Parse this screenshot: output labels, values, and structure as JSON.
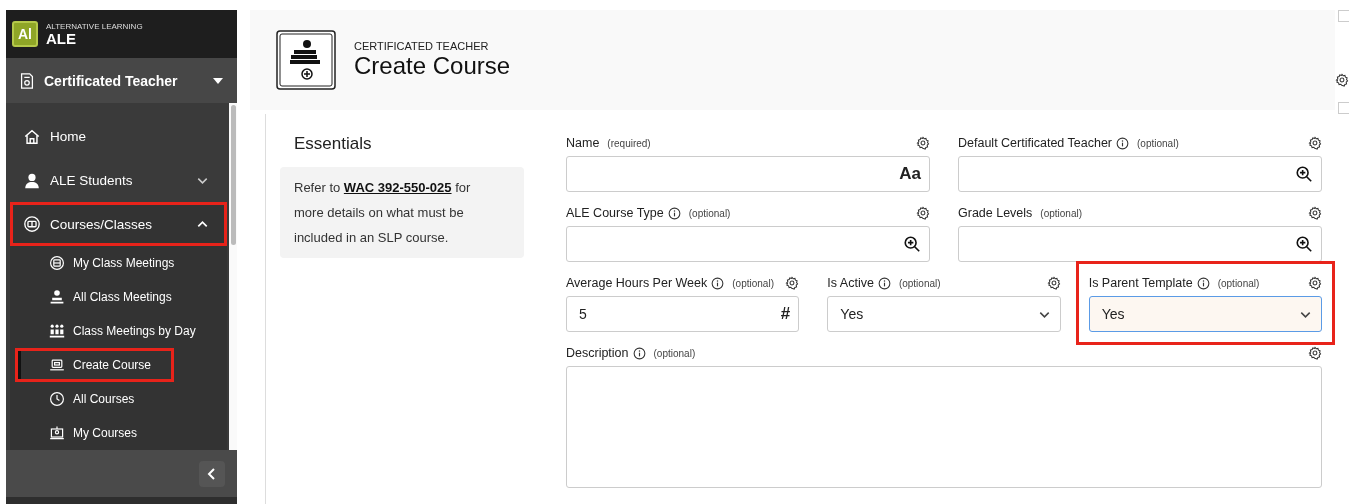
{
  "app": {
    "logo": "Al",
    "subtitle": "ALTERNATIVE LEARNING",
    "title": "ALE"
  },
  "role": {
    "label": "Certificated Teacher"
  },
  "nav": [
    {
      "label": "Home",
      "expanded": false,
      "has_children": false,
      "highlighted": false
    },
    {
      "label": "ALE Students",
      "expanded": false,
      "has_children": true,
      "highlighted": false
    },
    {
      "label": "Courses/Classes",
      "expanded": true,
      "has_children": true,
      "highlighted": true,
      "children": [
        {
          "label": "My Class Meetings",
          "selected": false,
          "highlighted": false
        },
        {
          "label": "All Class Meetings",
          "selected": false,
          "highlighted": false
        },
        {
          "label": "Class Meetings by Day",
          "selected": false,
          "highlighted": false
        },
        {
          "label": "Create Course",
          "selected": true,
          "highlighted": true
        },
        {
          "label": "All Courses",
          "selected": false,
          "highlighted": false
        },
        {
          "label": "My Courses",
          "selected": false,
          "highlighted": false
        }
      ]
    }
  ],
  "header": {
    "overline": "CERTIFICATED TEACHER",
    "title": "Create Course"
  },
  "section": {
    "title": "Essentials",
    "note_before": "Refer to ",
    "note_link": "WAC 392-550-025",
    "note_after": " for more details on what must be included in an SLP course."
  },
  "rows": [
    [
      {
        "kind": "text",
        "label": "Name",
        "info": false,
        "qualifier": "(required)",
        "suffix": "Aa",
        "highlighted": false,
        "focused": false
      },
      {
        "kind": "lookup",
        "label": "Default Certificated Teacher",
        "info": true,
        "qualifier": "(optional)",
        "highlighted": false,
        "focused": false
      }
    ],
    [
      {
        "kind": "lookup",
        "label": "ALE Course Type",
        "info": true,
        "qualifier": "(optional)",
        "highlighted": false,
        "focused": false
      },
      {
        "kind": "lookup",
        "label": "Grade Levels",
        "info": false,
        "qualifier": "(optional)",
        "highlighted": false,
        "focused": false
      }
    ],
    [
      {
        "kind": "number",
        "label": "Average Hours Per Week",
        "info": true,
        "qualifier": "(optional)",
        "value": "5",
        "suffix": "#",
        "highlighted": false,
        "focused": false
      },
      {
        "kind": "select",
        "label": "Is Active",
        "info": true,
        "qualifier": "(optional)",
        "value": "Yes",
        "highlighted": false,
        "focused": false
      },
      {
        "kind": "select",
        "label": "Is Parent Template",
        "info": true,
        "qualifier": "(optional)",
        "value": "Yes",
        "highlighted": true,
        "focused": true
      }
    ],
    [
      {
        "kind": "textarea",
        "label": "Description",
        "info": true,
        "qualifier": "(optional)",
        "highlighted": false,
        "focused": false
      }
    ]
  ]
}
